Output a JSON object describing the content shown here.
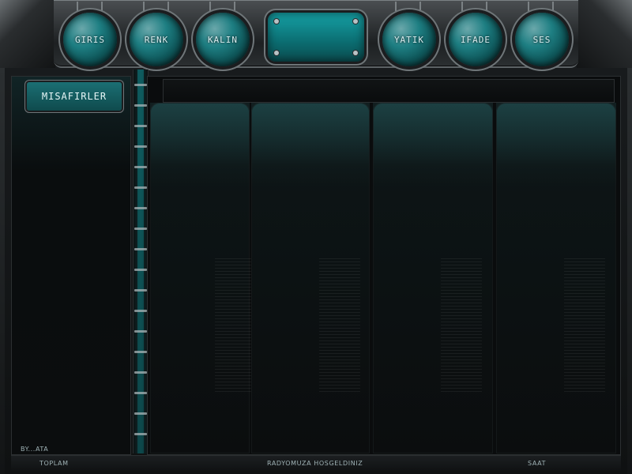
{
  "toolbar": {
    "buttons": [
      {
        "label": "GIRIS"
      },
      {
        "label": "RENK"
      },
      {
        "label": "KALIN"
      },
      {
        "label": "YATIK"
      },
      {
        "label": "IFADE"
      },
      {
        "label": "SES"
      }
    ]
  },
  "sidebar": {
    "tab_label": "MISAFIRLER"
  },
  "footer": {
    "by": "BY...ATA",
    "total_label": "TOPLAM",
    "welcome": "RADYOMUZA HOSGELDINIZ",
    "time_label": "SAAT"
  },
  "colors": {
    "accent": "#0f8f95",
    "background": "#0b0d0e"
  }
}
